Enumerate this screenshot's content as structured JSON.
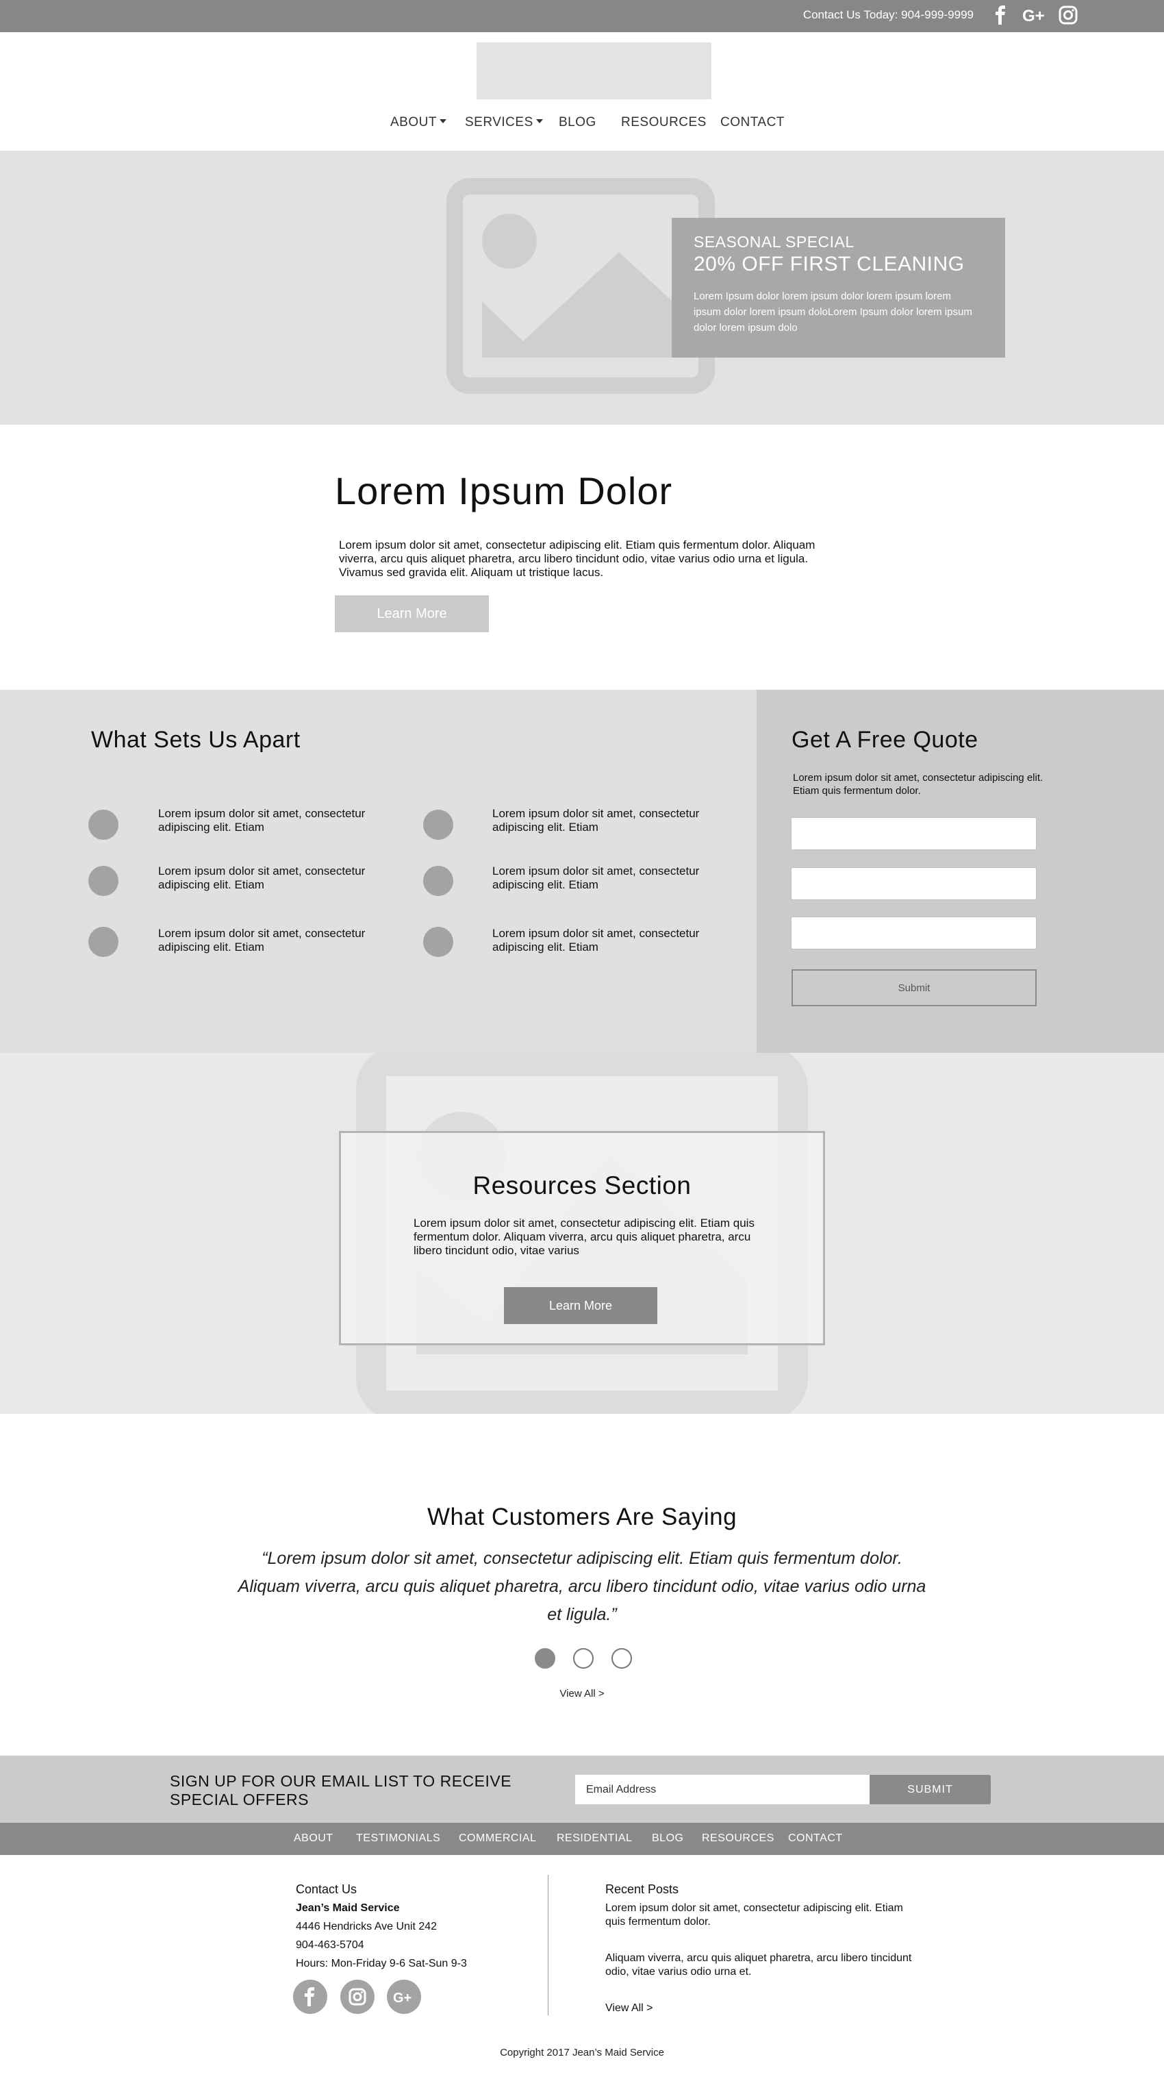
{
  "topbar": {
    "contact": "Contact Us Today: 904-999-9999",
    "social": [
      "facebook-icon",
      "google-plus-icon",
      "instagram-icon"
    ]
  },
  "header": {
    "nav": [
      {
        "label": "ABOUT",
        "dropdown": true
      },
      {
        "label": "SERVICES",
        "dropdown": true
      },
      {
        "label": "BLOG",
        "dropdown": false
      },
      {
        "label": "RESOURCES",
        "dropdown": false
      },
      {
        "label": "CONTACT",
        "dropdown": false
      }
    ]
  },
  "hero": {
    "kicker": "SEASONAL SPECIAL",
    "headline": "20% OFF FIRST CLEANING",
    "text": "Lorem Ipsum dolor lorem ipsum dolor lorem ipsum lorem ipsum dolor lorem ipsum doloLorem Ipsum dolor lorem ipsum dolor lorem ipsum dolo"
  },
  "intro": {
    "title": "Lorem Ipsum Dolor",
    "text": "Lorem ipsum dolor sit amet, consectetur adipiscing elit. Etiam quis fermentum dolor. Aliquam viverra, arcu quis aliquet pharetra, arcu libero tincidunt odio, vitae varius odio urna et ligula. Vivamus sed gravida elit. Aliquam ut tristique lacus.",
    "button": "Learn More"
  },
  "apart": {
    "title": "What Sets Us Apart",
    "features": [
      "Lorem ipsum dolor sit amet, consectetur adipiscing elit. Etiam",
      "Lorem ipsum dolor sit amet, consectetur adipiscing elit. Etiam",
      "Lorem ipsum dolor sit amet, consectetur adipiscing elit. Etiam",
      "Lorem ipsum dolor sit amet, consectetur adipiscing elit. Etiam",
      "Lorem ipsum dolor sit amet, consectetur adipiscing elit. Etiam",
      "Lorem ipsum dolor sit amet, consectetur adipiscing elit. Etiam"
    ]
  },
  "quote": {
    "title": "Get A Free Quote",
    "text": "Lorem ipsum dolor sit amet, consectetur adipiscing elit. Etiam quis fermentum dolor.",
    "submit": "Submit"
  },
  "resources": {
    "title": "Resources Section",
    "text": "Lorem ipsum dolor sit amet, consectetur adipiscing elit. Etiam quis fermentum dolor. Aliquam viverra, arcu quis aliquet pharetra, arcu libero tincidunt odio, vitae varius",
    "button": "Learn More"
  },
  "testimonials": {
    "title": "What Customers Are Saying",
    "quote": "“Lorem ipsum dolor sit amet, consectetur adipiscing elit. Etiam quis fermentum dolor. Aliquam viverra, arcu quis aliquet pharetra, arcu libero tincidunt odio, vitae varius odio urna et ligula.”",
    "view_all": "View All >"
  },
  "signup": {
    "text": "SIGN UP FOR OUR EMAIL LIST TO  RECEIVE SPECIAL OFFERS",
    "input_value": "Email Address",
    "button": "SUBMIT"
  },
  "footer_nav": [
    "ABOUT",
    "TESTIMONIALS",
    "COMMERCIAL",
    "RESIDENTIAL",
    "BLOG",
    "RESOURCES",
    "CONTACT"
  ],
  "footer": {
    "contact_heading": "Contact Us",
    "company": "Jean’s Maid Service",
    "address": "4446 Hendricks Ave Unit 242",
    "phone": "904-463-5704",
    "hours": "Hours: Mon-Friday 9-6   Sat-Sun 9-3",
    "social": [
      "facebook-icon",
      "instagram-icon",
      "google-plus-icon"
    ],
    "posts_heading": "Recent Posts",
    "post1": "Lorem ipsum dolor sit amet, consectetur adipiscing elit. Etiam quis fermentum dolor.",
    "post2": "Aliquam viverra, arcu quis aliquet pharetra, arcu libero tincidunt odio, vitae varius odio urna et.",
    "view_all": "View All >",
    "copyright": "Copyright 2017 Jean’s Maid Service"
  },
  "colors": {
    "dark_gray": "#878787",
    "mid_gray": "#a8a8a8",
    "light_gray": "#e2e2e2",
    "panel_gray": "#cbcbcb"
  }
}
